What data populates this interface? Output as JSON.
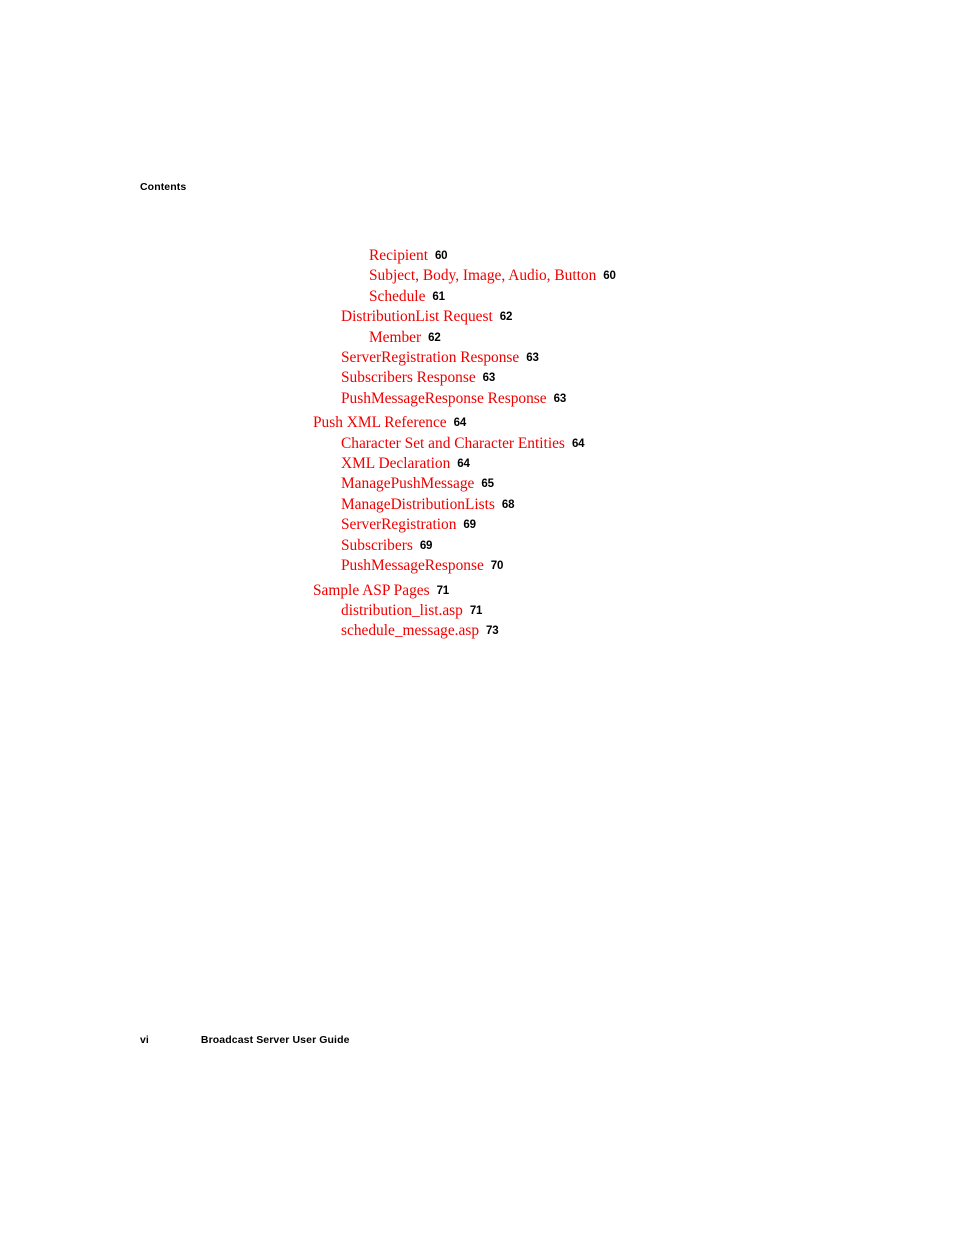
{
  "header": {
    "title": "Contents"
  },
  "footer": {
    "folio": "vi",
    "doc_title": "Broadcast Server User Guide"
  },
  "colors": {
    "entry_red": "#f00000",
    "page_number_black": "#000000",
    "page_background": "#ffffff"
  },
  "toc": {
    "entries": [
      {
        "title": "Recipient",
        "page": "60",
        "level": 3,
        "group_start": false
      },
      {
        "title": "Subject, Body, Image, Audio, Button",
        "page": "60",
        "level": 3,
        "group_start": false
      },
      {
        "title": "Schedule",
        "page": "61",
        "level": 3,
        "group_start": false
      },
      {
        "title": "DistributionList Request",
        "page": "62",
        "level": 2,
        "group_start": false
      },
      {
        "title": "Member",
        "page": "62",
        "level": 3,
        "group_start": false
      },
      {
        "title": "ServerRegistration Response",
        "page": "63",
        "level": 2,
        "group_start": false
      },
      {
        "title": "Subscribers Response",
        "page": "63",
        "level": 2,
        "group_start": false
      },
      {
        "title": "PushMessageResponse Response",
        "page": "63",
        "level": 2,
        "group_start": false
      },
      {
        "title": "Push XML Reference",
        "page": "64",
        "level": 1,
        "group_start": true
      },
      {
        "title": "Character Set and Character Entities",
        "page": "64",
        "level": 2,
        "group_start": false
      },
      {
        "title": "XML Declaration",
        "page": "64",
        "level": 2,
        "group_start": false
      },
      {
        "title": "ManagePushMessage",
        "page": "65",
        "level": 2,
        "group_start": false
      },
      {
        "title": "ManageDistributionLists",
        "page": "68",
        "level": 2,
        "group_start": false
      },
      {
        "title": "ServerRegistration",
        "page": "69",
        "level": 2,
        "group_start": false
      },
      {
        "title": "Subscribers",
        "page": "69",
        "level": 2,
        "group_start": false
      },
      {
        "title": "PushMessageResponse",
        "page": "70",
        "level": 2,
        "group_start": false
      },
      {
        "title": "Sample ASP Pages",
        "page": "71",
        "level": 1,
        "group_start": true
      },
      {
        "title": "distribution_list.asp",
        "page": "71",
        "level": 2,
        "group_start": false
      },
      {
        "title": "schedule_message.asp",
        "page": "73",
        "level": 2,
        "group_start": false
      }
    ]
  }
}
